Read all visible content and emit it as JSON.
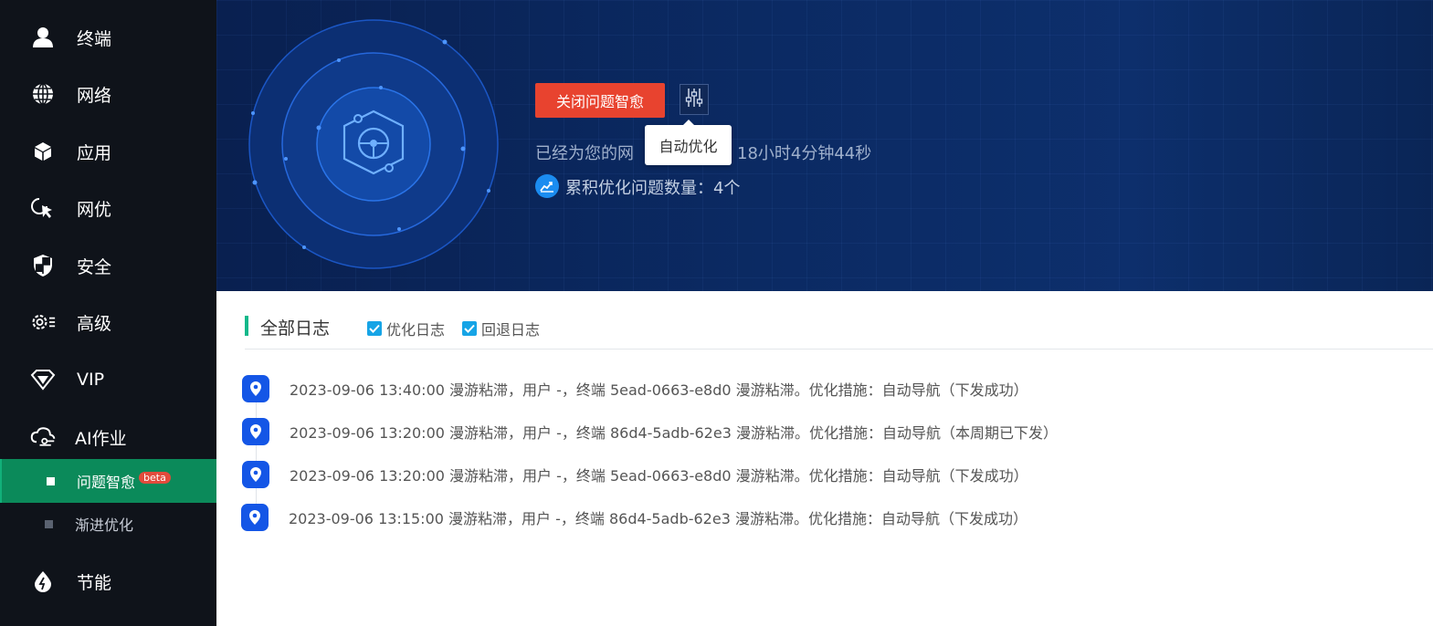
{
  "sidebar": {
    "items": [
      {
        "label": "终端",
        "icon": "user-icon"
      },
      {
        "label": "网络",
        "icon": "globe-icon"
      },
      {
        "label": "应用",
        "icon": "cube-icon"
      },
      {
        "label": "网优",
        "icon": "cursor-click-icon"
      },
      {
        "label": "安全",
        "icon": "shield-icon"
      },
      {
        "label": "高级",
        "icon": "gear-icon"
      },
      {
        "label": "VIP",
        "icon": "diamond-icon"
      },
      {
        "label": "AI作业",
        "icon": "cloud-ai-icon"
      }
    ],
    "sub_items": [
      {
        "label": "问题智愈",
        "badge": "beta",
        "active": true
      },
      {
        "label": "渐进优化",
        "active": false
      }
    ],
    "bottom_item": {
      "label": "节能",
      "icon": "leaf-icon"
    }
  },
  "hero": {
    "close_button": "关闭问题智愈",
    "settings_icon": "sliders-icon",
    "tooltip": "自动优化",
    "status_prefix": "已经为您的网",
    "status_suffix": "18小时4分钟44秒",
    "stat_text": "累积优化问题数量：4个"
  },
  "log": {
    "title": "全部日志",
    "filters": [
      {
        "label": "优化日志",
        "checked": true
      },
      {
        "label": "回退日志",
        "checked": true
      }
    ],
    "entries": [
      "2023-09-06 13:40:00 漫游粘滞，用户 -，终端 5ead-0663-e8d0 漫游粘滞。优化措施：自动导航（下发成功）",
      "2023-09-06 13:20:00 漫游粘滞，用户 -，终端 86d4-5adb-62e3 漫游粘滞。优化措施：自动导航（本周期已下发）",
      "2023-09-06 13:20:00 漫游粘滞，用户 -，终端 5ead-0663-e8d0 漫游粘滞。优化措施：自动导航（下发成功）",
      "2023-09-06 13:15:00 漫游粘滞，用户 -，终端 86d4-5adb-62e3 漫游粘滞。优化措施：自动导航（下发成功）"
    ]
  },
  "colors": {
    "sidebar_bg": "#0f131a",
    "active_item_bg": "#0b8a5a",
    "close_button_bg": "#e8432f",
    "checkbox": "#16a4e6",
    "pin": "#1456e6",
    "accent_bar": "#12b88a"
  }
}
